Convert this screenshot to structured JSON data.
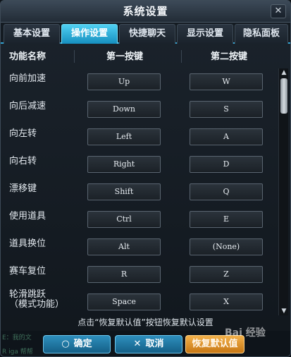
{
  "window": {
    "title": "系统设置",
    "close_label": "✕"
  },
  "tabs": [
    {
      "label": "基本设置",
      "active": false
    },
    {
      "label": "操作设置",
      "active": true
    },
    {
      "label": "快捷聊天",
      "active": false
    },
    {
      "label": "显示设置",
      "active": false
    },
    {
      "label": "隐私面板",
      "active": false
    }
  ],
  "columns": {
    "function": "功能名称",
    "primary": "第一按键",
    "secondary": "第二按键"
  },
  "rows": [
    {
      "label": "向前加速",
      "key1": "Up",
      "key2": "W"
    },
    {
      "label": "向后减速",
      "key1": "Down",
      "key2": "S"
    },
    {
      "label": "向左转",
      "key1": "Left",
      "key2": "A"
    },
    {
      "label": "向右转",
      "key1": "Right",
      "key2": "D"
    },
    {
      "label": "漂移键",
      "key1": "Shift",
      "key2": "Q"
    },
    {
      "label": "使用道具",
      "key1": "Ctrl",
      "key2": "E"
    },
    {
      "label": "道具换位",
      "key1": "Alt",
      "key2": "(None)"
    },
    {
      "label": "赛车复位",
      "key1": "R",
      "key2": "Z"
    },
    {
      "label": "轮滑跳跃\n（模式功能）",
      "key1": "Space",
      "key2": "X"
    }
  ],
  "hint": "点击“恢复默认值”按钮恢复默认设置",
  "footer": {
    "ok_label": "确定",
    "cancel_label": "取消",
    "reset_label": "恢复默认值",
    "ok_icon": "○",
    "cancel_icon": "✕",
    "background_chat_1": "E：我的文",
    "background_chat_2": "R  iga  帮帮"
  },
  "watermark": "Bai 经验",
  "colors": {
    "accent": "#2fa4d3",
    "reset": "#e9a23b"
  }
}
